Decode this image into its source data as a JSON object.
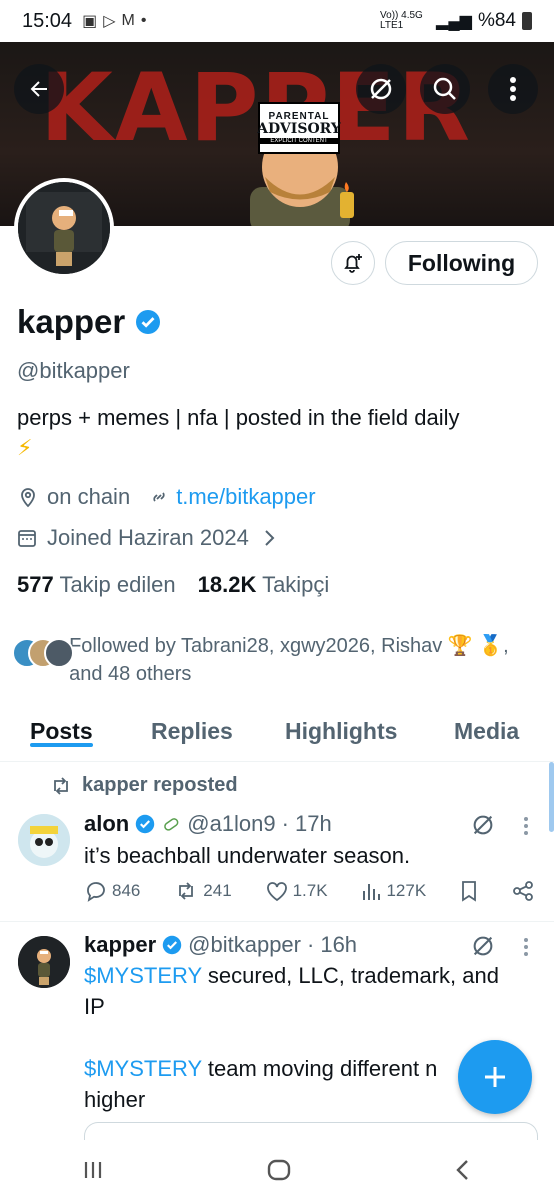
{
  "status_bar": {
    "time": "15:04",
    "network": "Vo)) 4.5G LTE1",
    "battery": "%84"
  },
  "banner": {
    "title_art": "KAPPER",
    "sticker_line1": "PARENTAL",
    "sticker_line2": "ADVISORY",
    "sticker_line3": "EXPLICIT CONTENT"
  },
  "profile": {
    "name": "kapper",
    "handle": "@bitkapper",
    "bio": "perps + memes | nfa | posted in the field daily",
    "bio_emoji": "⚡",
    "location": "on chain",
    "link": "t.me/bitkapper",
    "joined": "Joined Haziran 2024",
    "following_count": "577",
    "following_label": "Takip edilen",
    "followers_count": "18.2K",
    "followers_label": "Takipçi",
    "followed_by": "Followed by Tabrani28, xgwy2026, Rishav 🏆 🥇, and 48 others",
    "following_button": "Following"
  },
  "tabs": [
    "Posts",
    "Replies",
    "Highlights",
    "Media"
  ],
  "posts": [
    {
      "repost_label": "kapper reposted",
      "name": "alon",
      "handle": "@a1lon9",
      "time": "17h",
      "text": "it’s beachball underwater season.",
      "replies": "846",
      "reposts": "241",
      "likes": "1.7K",
      "views": "127K"
    },
    {
      "name": "kapper",
      "handle": "@bitkapper",
      "time": "16h",
      "cashtag": "$MYSTERY",
      "line1": " secured, LLC, trademark, and IP",
      "line2": " team moving different n",
      "line3": "higher"
    }
  ],
  "colors": {
    "accent": "#1d9bf0",
    "text": "#0f1419",
    "muted": "#536471",
    "banner_red": "#a8201a"
  }
}
